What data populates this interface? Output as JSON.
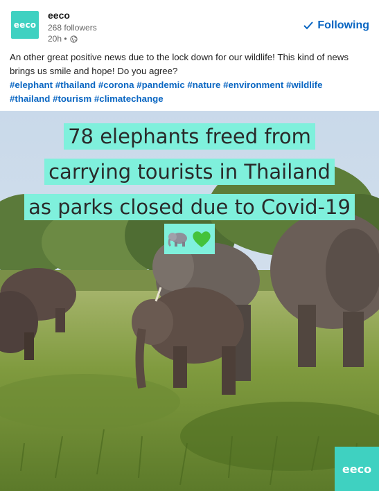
{
  "post": {
    "company_logo_text": "eeco",
    "company_name": "eeco",
    "followers": "268 followers",
    "time": "20h •",
    "follow_label": "Following",
    "text": "An other great positive news due to the lock down for our wildlife! This kind of news brings us smile and hope! Do you agree?",
    "hashtags_line1": "#elephant #thailand #corona #pandemic #nature #environment #wildlife",
    "hashtags_line2": "#thailand #tourism #climatechange"
  },
  "image": {
    "headline_lines": [
      "78 elephants freed from",
      "carrying tourists in Thailand",
      "as parks closed due to Covid-19"
    ],
    "badge_text": "eeco",
    "emojis": [
      "elephant-icon",
      "green-heart-icon"
    ]
  },
  "colors": {
    "brand": "#3fd1c1",
    "highlight": "#7ff0dc",
    "link": "#0a66c2"
  }
}
